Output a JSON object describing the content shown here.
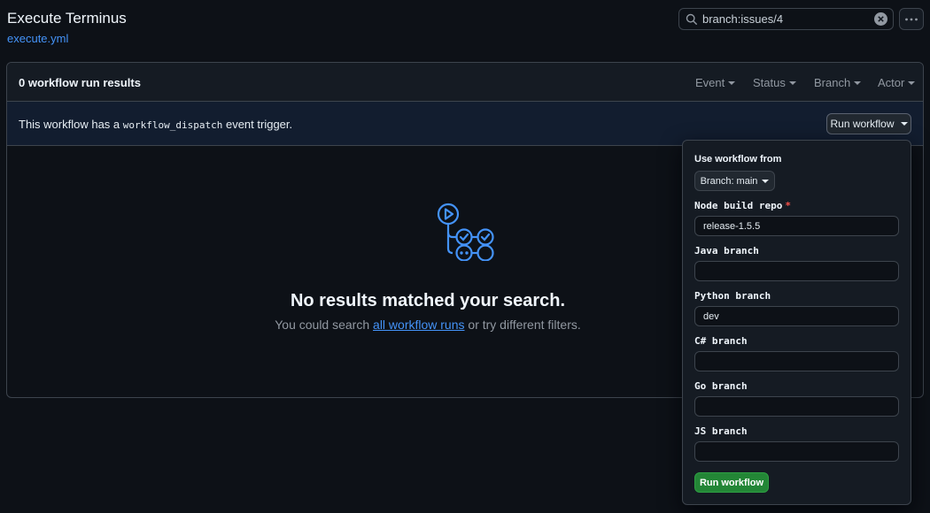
{
  "header": {
    "title": "Execute Terminus",
    "file_link": "execute.yml",
    "search_value": "branch:issues/4"
  },
  "results": {
    "count_label": "0 workflow run results",
    "filters": [
      "Event",
      "Status",
      "Branch",
      "Actor"
    ]
  },
  "dispatch": {
    "text_before": "This workflow has a ",
    "code": "workflow_dispatch",
    "text_after": " event trigger.",
    "run_button": "Run workflow"
  },
  "empty": {
    "title": "No results matched your search.",
    "sub_before": "You could search ",
    "sub_link": "all workflow runs",
    "sub_after": " or try different filters."
  },
  "dropdown": {
    "heading": "Use workflow from",
    "branch_button": "Branch: main",
    "fields": [
      {
        "label": "Node build repo",
        "required": true,
        "value": ""
      },
      {
        "label": "Java branch",
        "value": ""
      },
      {
        "label": "Python branch",
        "value": "dev"
      },
      {
        "label": "C# branch",
        "value": ""
      },
      {
        "label": "Go branch",
        "value": ""
      },
      {
        "label": "JS branch",
        "value": ""
      }
    ],
    "node_value": "release-1.5.5",
    "submit": "Run workflow"
  },
  "colors": {
    "accent_blue": "#4493f8",
    "success_green": "#238636",
    "danger_red": "#f85149"
  }
}
